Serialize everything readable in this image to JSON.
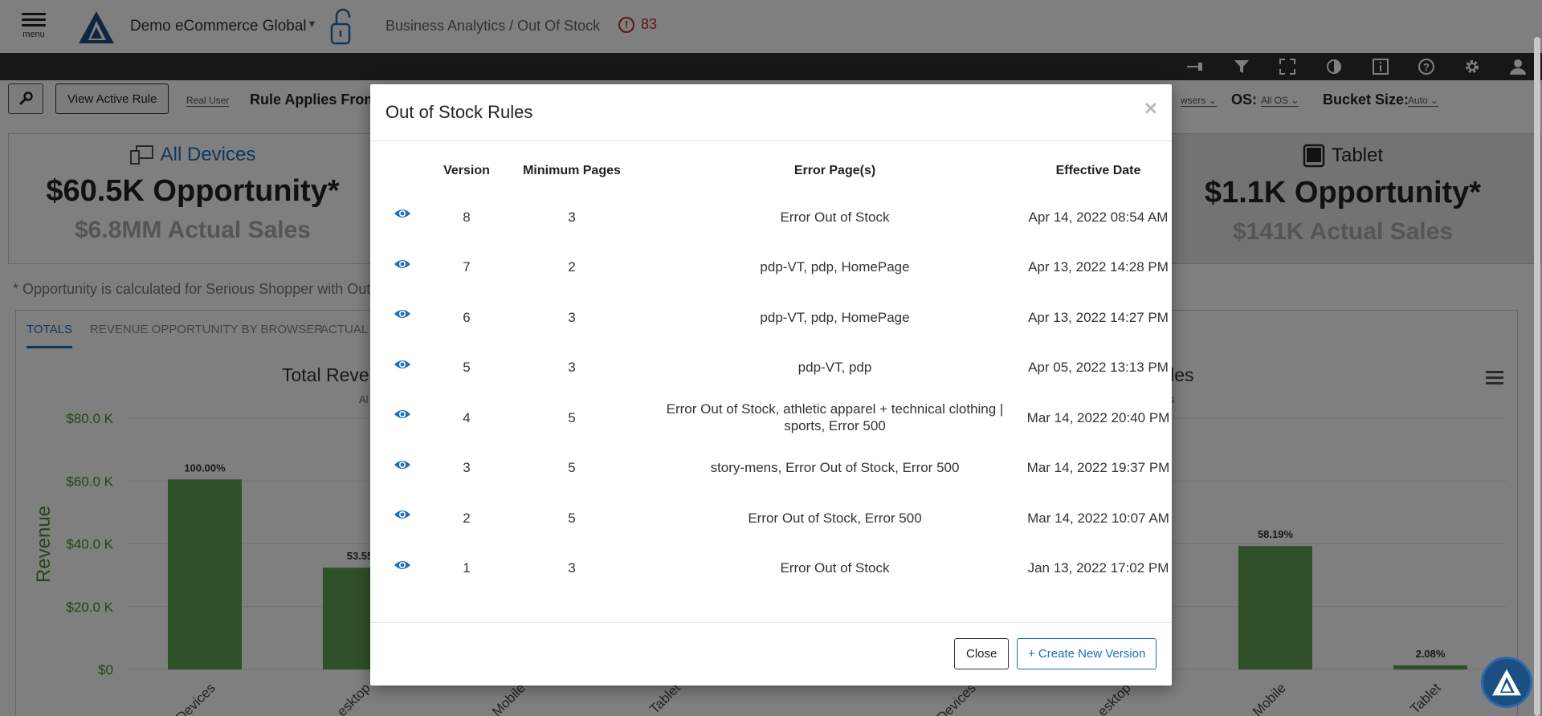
{
  "header": {
    "menu_label": "menu",
    "org_name": "Demo eCommerce Global",
    "breadcrumb": "Business Analytics / Out Of Stock",
    "alert_count": "83"
  },
  "toolbar_icons": [
    "pin-icon",
    "filter-icon",
    "fullscreen-icon",
    "contrast-icon",
    "info-panel-icon",
    "help-icon",
    "gear-icon",
    "user-icon"
  ],
  "filters": {
    "view_active_rule": "View Active Rule",
    "real_user": "Real User",
    "rule_applies_from": "Rule Applies From:",
    "browsers": "wsers",
    "os_label": "OS:",
    "os_value": "All OS",
    "bucket_label": "Bucket Size:",
    "bucket_value": "Auto"
  },
  "cards": {
    "all": {
      "title": "All Devices",
      "opportunity": "$60.5K Opportunity*",
      "sales": "$6.8MM Actual Sales"
    },
    "tablet": {
      "title": "Tablet",
      "opportunity": "$1.1K Opportunity*",
      "sales": "$141K Actual Sales"
    }
  },
  "note": "* Opportunity is calculated for Serious Shopper with Out o",
  "tabs": [
    "TOTALS",
    "REVENUE OPPORTUNITY BY BROWSER",
    "ACTUAL"
  ],
  "charts": {
    "left_title": "Total Reven",
    "left_sub": "Al",
    "right_title": "Sales",
    "right_sub": "s"
  },
  "chart_data": [
    {
      "type": "bar",
      "title": "Total Reven",
      "ylabel": "Revenue",
      "yticks": [
        "$0",
        "$20.0 K",
        "$40.0 K",
        "$60.0 K",
        "$80.0 K"
      ],
      "ylim": [
        0,
        80000
      ],
      "categories": [
        "Devices",
        "esktop",
        "Mobile",
        "Tablet"
      ],
      "values": [
        60500,
        32400,
        null,
        null
      ],
      "data_labels": [
        "100.00%",
        "53.55",
        "",
        ""
      ],
      "color": "#5fa052"
    },
    {
      "type": "bar",
      "title": "Sales",
      "ylim": [
        0,
        80000
      ],
      "categories": [
        "Devices",
        "esktop",
        "Mobile",
        "Tablet"
      ],
      "values": [
        null,
        null,
        39300,
        1300
      ],
      "data_labels": [
        "",
        "",
        "58.19%",
        "2.08%"
      ],
      "color": "#5fa052"
    }
  ],
  "modal": {
    "title": "Out of Stock Rules",
    "close_x": "×",
    "columns": [
      "Version",
      "Minimum Pages",
      "Error Page(s)",
      "Effective Date"
    ],
    "rows": [
      {
        "version": "8",
        "min_pages": "3",
        "error_pages": "Error Out of Stock",
        "date": "Apr 14, 2022 08:54 AM"
      },
      {
        "version": "7",
        "min_pages": "2",
        "error_pages": "pdp-VT, pdp, HomePage",
        "date": "Apr 13, 2022 14:28 PM"
      },
      {
        "version": "6",
        "min_pages": "3",
        "error_pages": "pdp-VT, pdp, HomePage",
        "date": "Apr 13, 2022 14:27 PM"
      },
      {
        "version": "5",
        "min_pages": "3",
        "error_pages": "pdp-VT, pdp",
        "date": "Apr 05, 2022 13:13 PM"
      },
      {
        "version": "4",
        "min_pages": "5",
        "error_pages": "Error Out of Stock, athletic apparel + technical clothing | sports, Error 500",
        "date": "Mar 14, 2022 20:40 PM"
      },
      {
        "version": "3",
        "min_pages": "5",
        "error_pages": "story-mens, Error Out of Stock, Error 500",
        "date": "Mar 14, 2022 19:37 PM"
      },
      {
        "version": "2",
        "min_pages": "5",
        "error_pages": "Error Out of Stock, Error 500",
        "date": "Mar 14, 2022 10:07 AM"
      },
      {
        "version": "1",
        "min_pages": "3",
        "error_pages": "Error Out of Stock",
        "date": "Jan 13, 2022 17:02 PM"
      }
    ],
    "close_button": "Close",
    "create_button": "+ Create New Version"
  },
  "colors": {
    "accent": "#1e6fb8",
    "alert": "#c62828",
    "bar": "#5fa052",
    "axis_label": "#4a8a32"
  }
}
